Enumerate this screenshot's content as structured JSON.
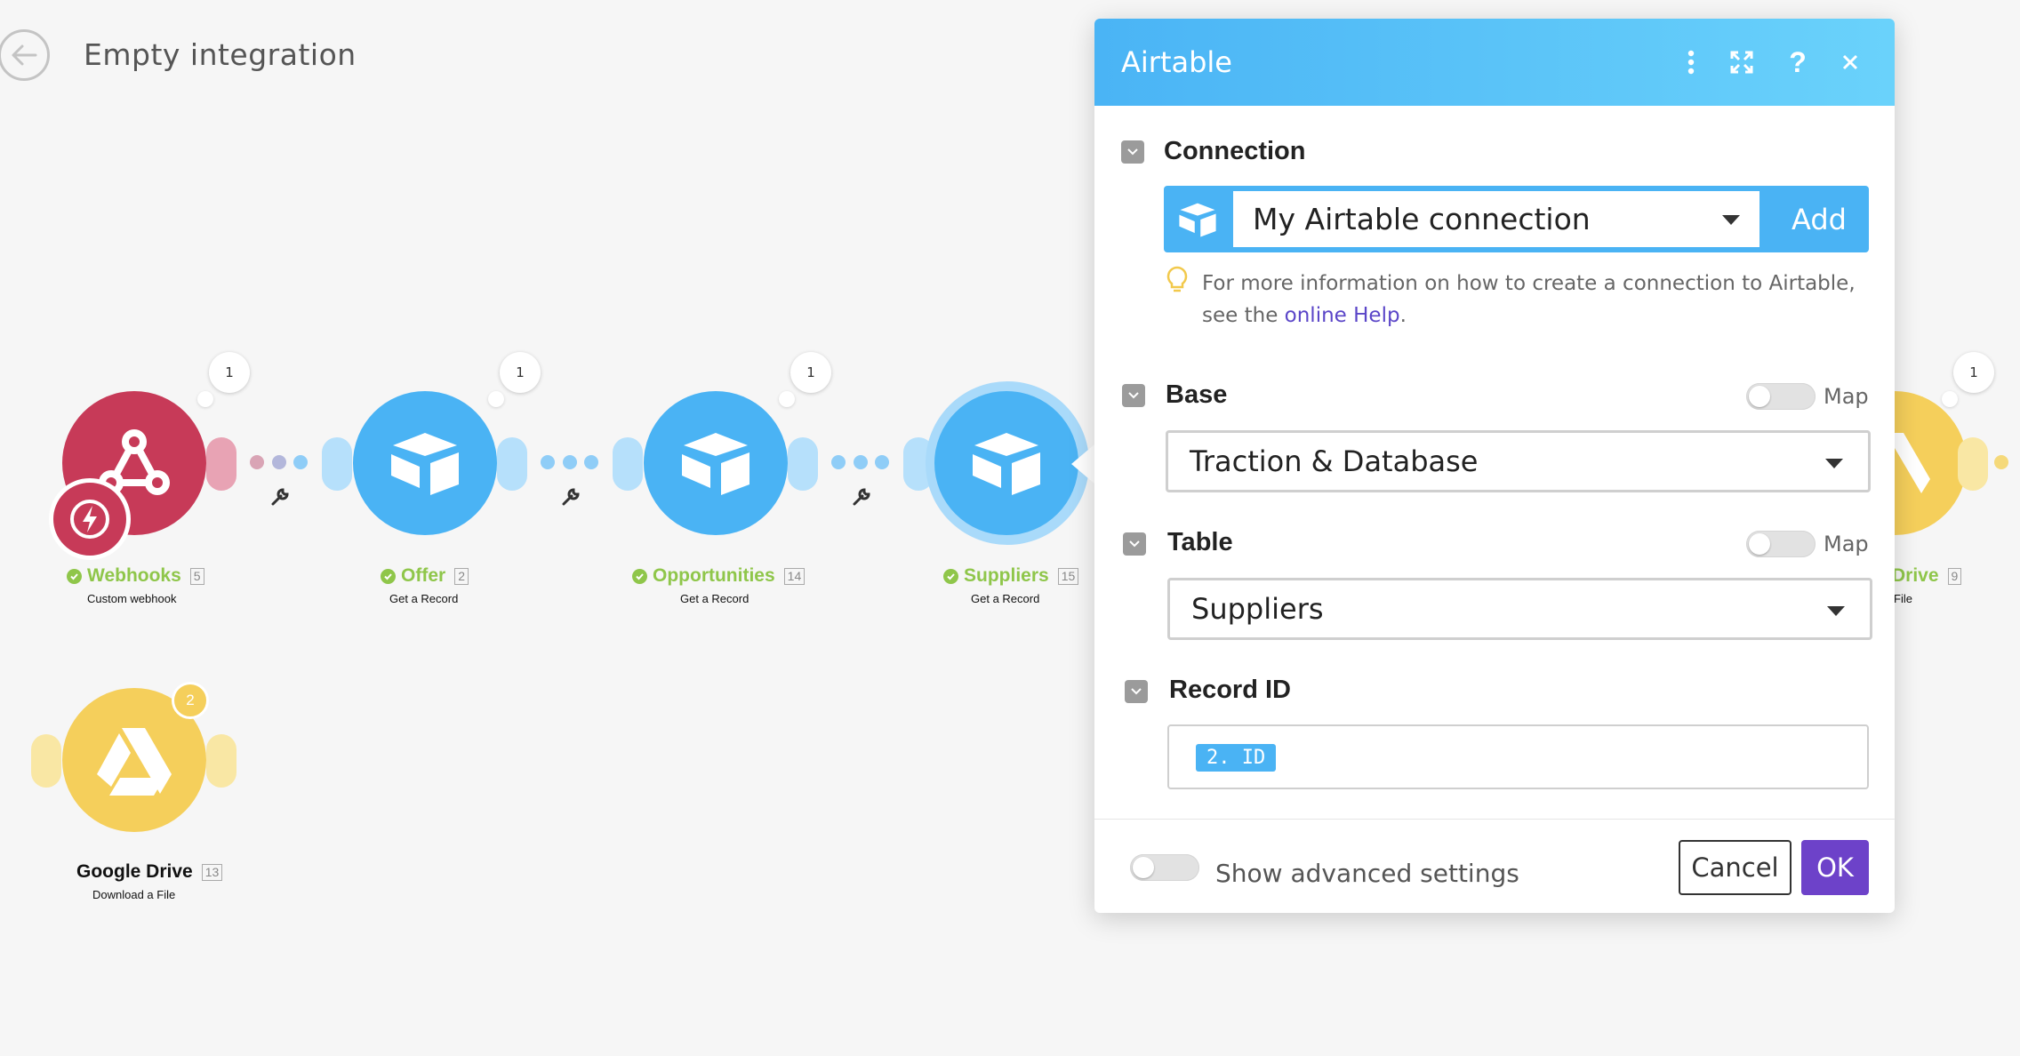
{
  "header": {
    "title": "Empty integration"
  },
  "modules": [
    {
      "name": "Webhooks",
      "id": "5",
      "sub": "Custom webhook",
      "bubble": "1"
    },
    {
      "name": "Offer",
      "id": "2",
      "sub": "Get a Record",
      "bubble": "1"
    },
    {
      "name": "Opportunities",
      "id": "14",
      "sub": "Get a Record",
      "bubble": "1"
    },
    {
      "name": "Suppliers",
      "id": "15",
      "sub": "Get a Record"
    },
    {
      "name": "Drive",
      "id": "9",
      "sub": "File",
      "bubble": "1"
    },
    {
      "name": "Google Drive",
      "id": "13",
      "sub": "Download a File",
      "badge": "2"
    }
  ],
  "panel": {
    "title": "Airtable",
    "connection": {
      "label": "Connection",
      "value": "My Airtable connection",
      "add_label": "Add",
      "hint_prefix": "For more information on how to create a connection to Airtable, see the ",
      "hint_link": "online Help",
      "hint_suffix": "."
    },
    "base": {
      "label": "Base",
      "map_label": "Map",
      "value": "Traction & Database"
    },
    "table": {
      "label": "Table",
      "map_label": "Map",
      "value": "Suppliers"
    },
    "record": {
      "label": "Record ID",
      "pill": "2. ID"
    },
    "footer": {
      "advanced_label": "Show advanced settings",
      "cancel_label": "Cancel",
      "ok_label": "OK"
    }
  },
  "colors": {
    "airtable_blue": "#4ab3f4",
    "webhooks_red": "#c73a58",
    "google_yellow": "#f5cf5b",
    "ok_purple": "#6d42c9",
    "success_green": "#8fc64a"
  }
}
